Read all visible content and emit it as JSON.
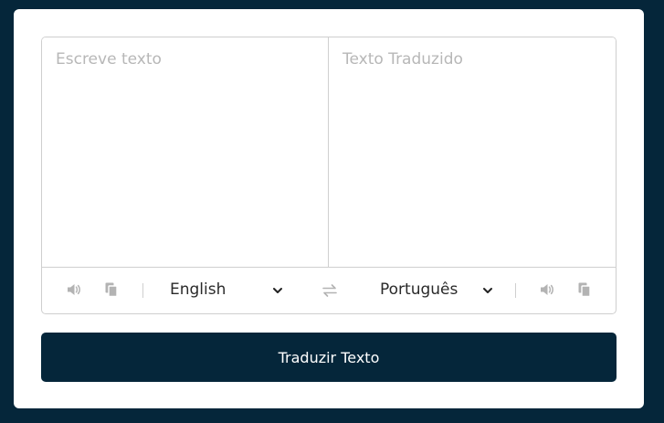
{
  "from": {
    "placeholder": "Escreve texto",
    "language": "English"
  },
  "to": {
    "placeholder": "Texto Traduzido",
    "language": "Português"
  },
  "button": {
    "label": "Traduzir Texto"
  },
  "colors": {
    "background": "#05263a",
    "card": "#ffffff",
    "border": "#cfcfcf",
    "icon": "#b3b3b3",
    "button": "#05263a"
  },
  "icons": [
    "volume-icon",
    "copy-icon",
    "chevron-down-icon",
    "exchange-icon"
  ]
}
